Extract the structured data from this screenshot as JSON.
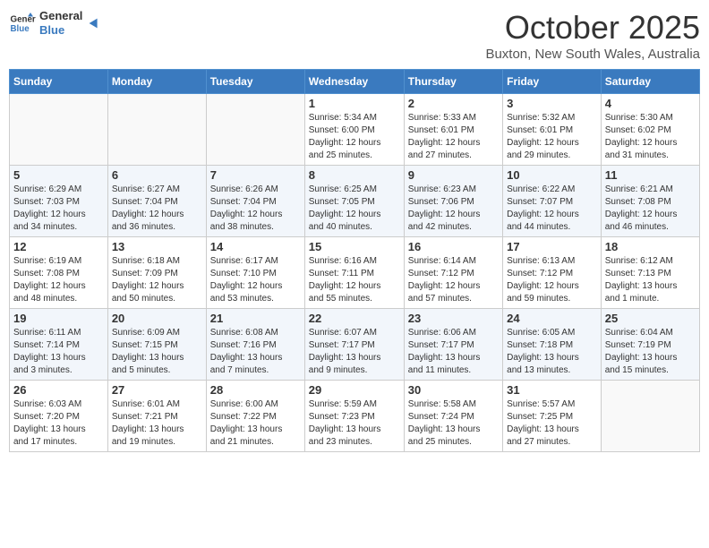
{
  "header": {
    "logo_general": "General",
    "logo_blue": "Blue",
    "month_title": "October 2025",
    "location": "Buxton, New South Wales, Australia"
  },
  "weekdays": [
    "Sunday",
    "Monday",
    "Tuesday",
    "Wednesday",
    "Thursday",
    "Friday",
    "Saturday"
  ],
  "weeks": [
    [
      {
        "day": "",
        "info": ""
      },
      {
        "day": "",
        "info": ""
      },
      {
        "day": "",
        "info": ""
      },
      {
        "day": "1",
        "info": "Sunrise: 5:34 AM\nSunset: 6:00 PM\nDaylight: 12 hours\nand 25 minutes."
      },
      {
        "day": "2",
        "info": "Sunrise: 5:33 AM\nSunset: 6:01 PM\nDaylight: 12 hours\nand 27 minutes."
      },
      {
        "day": "3",
        "info": "Sunrise: 5:32 AM\nSunset: 6:01 PM\nDaylight: 12 hours\nand 29 minutes."
      },
      {
        "day": "4",
        "info": "Sunrise: 5:30 AM\nSunset: 6:02 PM\nDaylight: 12 hours\nand 31 minutes."
      }
    ],
    [
      {
        "day": "5",
        "info": "Sunrise: 6:29 AM\nSunset: 7:03 PM\nDaylight: 12 hours\nand 34 minutes."
      },
      {
        "day": "6",
        "info": "Sunrise: 6:27 AM\nSunset: 7:04 PM\nDaylight: 12 hours\nand 36 minutes."
      },
      {
        "day": "7",
        "info": "Sunrise: 6:26 AM\nSunset: 7:04 PM\nDaylight: 12 hours\nand 38 minutes."
      },
      {
        "day": "8",
        "info": "Sunrise: 6:25 AM\nSunset: 7:05 PM\nDaylight: 12 hours\nand 40 minutes."
      },
      {
        "day": "9",
        "info": "Sunrise: 6:23 AM\nSunset: 7:06 PM\nDaylight: 12 hours\nand 42 minutes."
      },
      {
        "day": "10",
        "info": "Sunrise: 6:22 AM\nSunset: 7:07 PM\nDaylight: 12 hours\nand 44 minutes."
      },
      {
        "day": "11",
        "info": "Sunrise: 6:21 AM\nSunset: 7:08 PM\nDaylight: 12 hours\nand 46 minutes."
      }
    ],
    [
      {
        "day": "12",
        "info": "Sunrise: 6:19 AM\nSunset: 7:08 PM\nDaylight: 12 hours\nand 48 minutes."
      },
      {
        "day": "13",
        "info": "Sunrise: 6:18 AM\nSunset: 7:09 PM\nDaylight: 12 hours\nand 50 minutes."
      },
      {
        "day": "14",
        "info": "Sunrise: 6:17 AM\nSunset: 7:10 PM\nDaylight: 12 hours\nand 53 minutes."
      },
      {
        "day": "15",
        "info": "Sunrise: 6:16 AM\nSunset: 7:11 PM\nDaylight: 12 hours\nand 55 minutes."
      },
      {
        "day": "16",
        "info": "Sunrise: 6:14 AM\nSunset: 7:12 PM\nDaylight: 12 hours\nand 57 minutes."
      },
      {
        "day": "17",
        "info": "Sunrise: 6:13 AM\nSunset: 7:12 PM\nDaylight: 12 hours\nand 59 minutes."
      },
      {
        "day": "18",
        "info": "Sunrise: 6:12 AM\nSunset: 7:13 PM\nDaylight: 13 hours\nand 1 minute."
      }
    ],
    [
      {
        "day": "19",
        "info": "Sunrise: 6:11 AM\nSunset: 7:14 PM\nDaylight: 13 hours\nand 3 minutes."
      },
      {
        "day": "20",
        "info": "Sunrise: 6:09 AM\nSunset: 7:15 PM\nDaylight: 13 hours\nand 5 minutes."
      },
      {
        "day": "21",
        "info": "Sunrise: 6:08 AM\nSunset: 7:16 PM\nDaylight: 13 hours\nand 7 minutes."
      },
      {
        "day": "22",
        "info": "Sunrise: 6:07 AM\nSunset: 7:17 PM\nDaylight: 13 hours\nand 9 minutes."
      },
      {
        "day": "23",
        "info": "Sunrise: 6:06 AM\nSunset: 7:17 PM\nDaylight: 13 hours\nand 11 minutes."
      },
      {
        "day": "24",
        "info": "Sunrise: 6:05 AM\nSunset: 7:18 PM\nDaylight: 13 hours\nand 13 minutes."
      },
      {
        "day": "25",
        "info": "Sunrise: 6:04 AM\nSunset: 7:19 PM\nDaylight: 13 hours\nand 15 minutes."
      }
    ],
    [
      {
        "day": "26",
        "info": "Sunrise: 6:03 AM\nSunset: 7:20 PM\nDaylight: 13 hours\nand 17 minutes."
      },
      {
        "day": "27",
        "info": "Sunrise: 6:01 AM\nSunset: 7:21 PM\nDaylight: 13 hours\nand 19 minutes."
      },
      {
        "day": "28",
        "info": "Sunrise: 6:00 AM\nSunset: 7:22 PM\nDaylight: 13 hours\nand 21 minutes."
      },
      {
        "day": "29",
        "info": "Sunrise: 5:59 AM\nSunset: 7:23 PM\nDaylight: 13 hours\nand 23 minutes."
      },
      {
        "day": "30",
        "info": "Sunrise: 5:58 AM\nSunset: 7:24 PM\nDaylight: 13 hours\nand 25 minutes."
      },
      {
        "day": "31",
        "info": "Sunrise: 5:57 AM\nSunset: 7:25 PM\nDaylight: 13 hours\nand 27 minutes."
      },
      {
        "day": "",
        "info": ""
      }
    ]
  ]
}
